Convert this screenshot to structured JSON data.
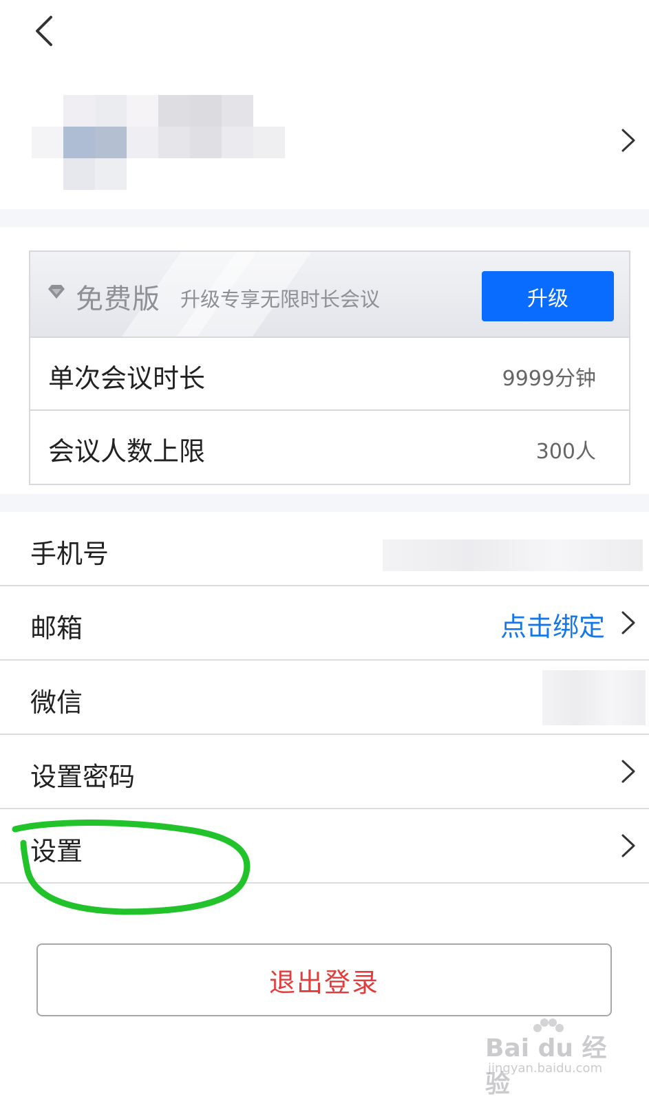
{
  "plan": {
    "name": "免费版",
    "tip": "升级专享无限时长会议",
    "upgrade_label": "升级",
    "rows": [
      {
        "label": "单次会议时长",
        "value": "9999分钟"
      },
      {
        "label": "会议人数上限",
        "value": "300人"
      }
    ]
  },
  "account": {
    "phone_label": "手机号",
    "email_label": "邮箱",
    "email_action": "点击绑定",
    "wechat_label": "微信",
    "password_label": "设置密码",
    "settings_label": "设置"
  },
  "logout_label": "退出登录",
  "watermark": {
    "text": "Bai du 经验",
    "sub": "jingyan.baidu.com"
  },
  "colors": {
    "accent": "#0a6cff",
    "link": "#1677e8",
    "danger": "#e23d3d",
    "highlight": "#22c22a"
  },
  "icons": [
    "back-arrow-icon",
    "chevron-right-icon",
    "diamond-icon"
  ]
}
